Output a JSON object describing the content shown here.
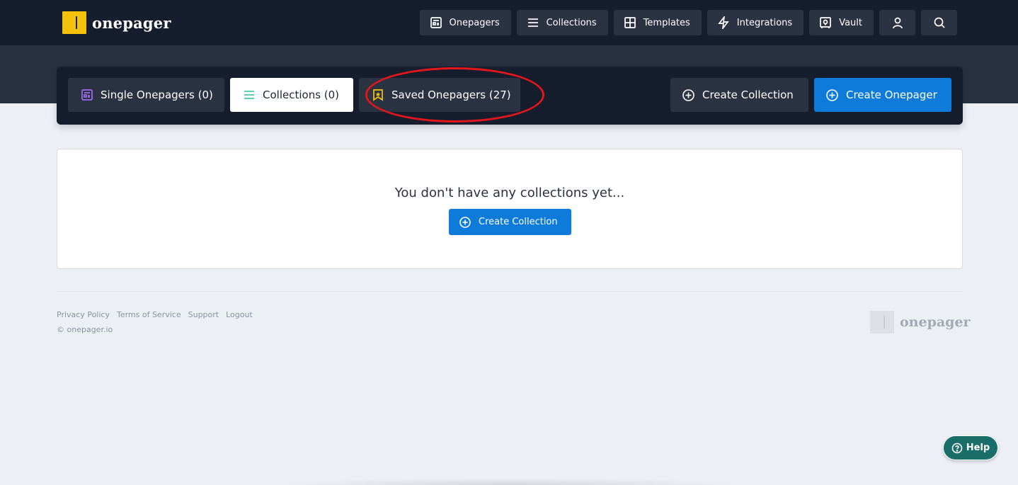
{
  "brand": {
    "name": "onepager",
    "accent": "#f5c20b"
  },
  "nav": {
    "items": [
      {
        "label": "Onepagers",
        "icon": "onepager-icon"
      },
      {
        "label": "Collections",
        "icon": "list-icon"
      },
      {
        "label": "Templates",
        "icon": "grid-icon"
      },
      {
        "label": "Integrations",
        "icon": "lightning-icon"
      },
      {
        "label": "Vault",
        "icon": "vault-icon"
      }
    ],
    "user_icon": "user-icon",
    "search_icon": "search-icon"
  },
  "tabs": [
    {
      "label": "Single Onepagers (0)",
      "icon": "onepager-icon",
      "icon_color": "#a26cf0",
      "active": false
    },
    {
      "label": "Collections (0)",
      "icon": "list-icon",
      "icon_color": "#3cc7a5",
      "active": true
    },
    {
      "label": "Saved Onepagers (27)",
      "icon": "star-bookmark-icon",
      "icon_color": "#f5c20b",
      "active": false
    }
  ],
  "actions": {
    "create_collection": "Create Collection",
    "create_onepager": "Create Onepager"
  },
  "empty_state": {
    "title": "You don't have any collections yet...",
    "button": "Create Collection"
  },
  "footer": {
    "links": [
      "Privacy Policy",
      "Terms of Service",
      "Support",
      "Logout"
    ],
    "copyright": "© onepager.io",
    "logo_text": "onepager"
  },
  "help": {
    "label": "Help"
  },
  "colors": {
    "topbar": "#161d2d",
    "button_dark": "#2b3342",
    "primary": "#0e7ad9",
    "annotation": "#e3161b",
    "help": "#1a6e69"
  }
}
